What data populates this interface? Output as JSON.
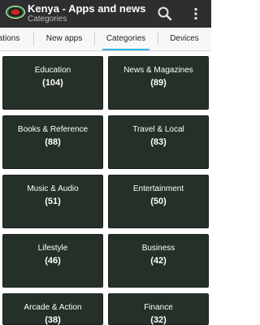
{
  "appbar": {
    "title": "Kenya - Apps and news",
    "subtitle": "Categories",
    "icons": {
      "logo": "kenya-flag-shield-icon",
      "search": "search-icon",
      "menu": "overflow-menu-icon"
    }
  },
  "tabs": [
    {
      "label": "ations"
    },
    {
      "label": "New apps"
    },
    {
      "label": "Categories",
      "active": true
    },
    {
      "label": "Devices"
    }
  ],
  "categories": [
    {
      "name": "Education",
      "count": "(104)"
    },
    {
      "name": "News & Magazines",
      "count": "(89)"
    },
    {
      "name": "Books & Reference",
      "count": "(88)"
    },
    {
      "name": "Travel & Local",
      "count": "(83)"
    },
    {
      "name": "Music & Audio",
      "count": "(51)"
    },
    {
      "name": "Entertainment",
      "count": "(50)"
    },
    {
      "name": "Lifestyle",
      "count": "(46)"
    },
    {
      "name": "Business",
      "count": "(42)"
    },
    {
      "name": "Arcade & Action",
      "count": "(38)"
    },
    {
      "name": "Finance",
      "count": "(32)"
    }
  ],
  "colors": {
    "appbar": "#2e2e2e",
    "tile": "#243028",
    "accent": "#33b5e5"
  }
}
